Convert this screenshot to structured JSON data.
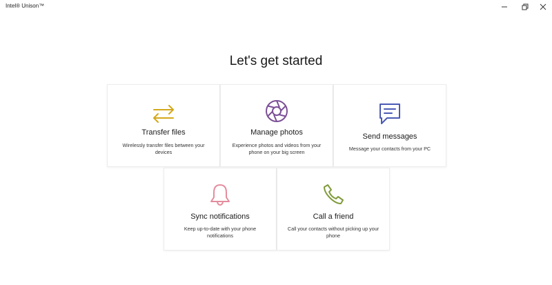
{
  "app": {
    "title": "Intel® Unison™"
  },
  "heading": "Let's get started",
  "cards": [
    {
      "title": "Transfer files",
      "description": "Wirelessly transfer files between your devices",
      "icon": "transfer-icon",
      "color": "#d4a81a"
    },
    {
      "title": "Manage photos",
      "description": "Experience photos and videos from your phone on your big screen",
      "icon": "aperture-icon",
      "color": "#7b4f96"
    },
    {
      "title": "Send messages",
      "description": "Message your contacts from your PC",
      "icon": "message-icon",
      "color": "#4a5ab4"
    },
    {
      "title": "Sync notifications",
      "description": "Keep up-to-date with your phone notifications",
      "icon": "bell-icon",
      "color": "#e58c9c"
    },
    {
      "title": "Call a friend",
      "description": "Call your contacts without picking up your phone",
      "icon": "phone-icon",
      "color": "#7f9a3a"
    }
  ]
}
